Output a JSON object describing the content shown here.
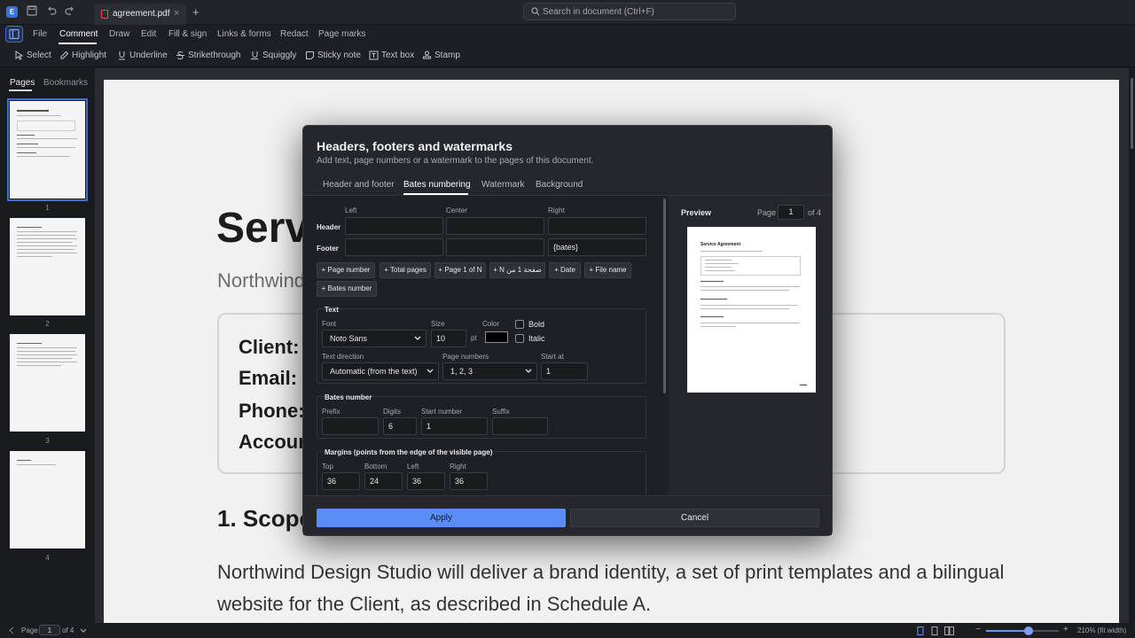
{
  "titlebar": {
    "app_icon": "E",
    "tab_title": "agreement.pdf",
    "tab_close": "×",
    "tab_add": "+",
    "search_placeholder": "Search in document (Ctrl+F)"
  },
  "menu": [
    "File",
    "Comment",
    "Draw",
    "Edit",
    "Fill & sign",
    "Links & forms",
    "Redact",
    "Page marks"
  ],
  "menu_active": "Comment",
  "toolbar": [
    "Select",
    "Highlight",
    "Underline",
    "Strikethrough",
    "Squiggly",
    "Sticky note",
    "Text box",
    "Stamp"
  ],
  "sidebar": {
    "tabs": [
      "Pages",
      "Bookmarks"
    ],
    "thumb_numbers": [
      "1",
      "2",
      "3",
      "4"
    ]
  },
  "document": {
    "title": "Serv",
    "subtitle": "Northwind",
    "fields": [
      "Client:",
      "Email:",
      "Phone:",
      "Accoun"
    ],
    "heading": "1. Scope",
    "paragraph": "Northwind Design Studio will deliver a brand identity, a set of print templates and a bilingual website for the Client, as described in Schedule A."
  },
  "dialog": {
    "title": "Headers, footers and watermarks",
    "subtitle": "Add text, page numbers or a watermark to the pages of this document.",
    "tabs": [
      "Header and footer",
      "Bates numbering",
      "Watermark",
      "Background"
    ],
    "active_tab": "Bates numbering",
    "columns": [
      "Left",
      "Center",
      "Right"
    ],
    "rows": [
      "Header",
      "Footer"
    ],
    "footer_right_value": "{bates}",
    "token_chips": [
      "+ Page number",
      "+ Total pages",
      "+ Page 1 of N",
      "+ N صفحة 1 من",
      "+ Date",
      "+ File name",
      "+ Bates number"
    ],
    "text_group": {
      "title": "Text",
      "font_label": "Font",
      "font_value": "Noto Sans",
      "size_label": "Size",
      "size_value": "10",
      "size_unit": "pt",
      "color_label": "Color",
      "color_value": "#000000",
      "bold_label": "Bold",
      "italic_label": "Italic",
      "direction_label": "Text direction",
      "direction_value": "Automatic (from the text)",
      "page_numbers_label": "Page numbers",
      "page_numbers_value": "1, 2, 3",
      "start_at_label": "Start at",
      "start_at_value": "1"
    },
    "bates_group": {
      "title": "Bates number",
      "prefix_label": "Prefix",
      "prefix_value": "",
      "digits_label": "Digits",
      "digits_value": "6",
      "start_label": "Start number",
      "start_value": "1",
      "suffix_label": "Suffix",
      "suffix_value": ""
    },
    "margins_group": {
      "title": "Margins (points from the edge of the visible page)",
      "top_label": "Top",
      "top_value": "36",
      "bottom_label": "Bottom",
      "bottom_value": "24",
      "left_label": "Left",
      "left_value": "36",
      "right_label": "Right",
      "right_value": "36"
    },
    "preview": {
      "title": "Preview",
      "page_label": "Page",
      "page_value": "1",
      "of_label": "of 4",
      "doc_title": "Service Agreement"
    },
    "apply_label": "Apply",
    "cancel_label": "Cancel"
  },
  "status": {
    "page_label": "Page",
    "page_value": "1",
    "of_label": "of 4",
    "zoom_label": "210% (fit width)",
    "zoom_minus": "−",
    "zoom_plus": "+",
    "zoom_fraction": 0.58
  },
  "colors": {
    "accent": "#5b8ef5",
    "background": "#1b1c21",
    "dialog": "#26272d"
  }
}
